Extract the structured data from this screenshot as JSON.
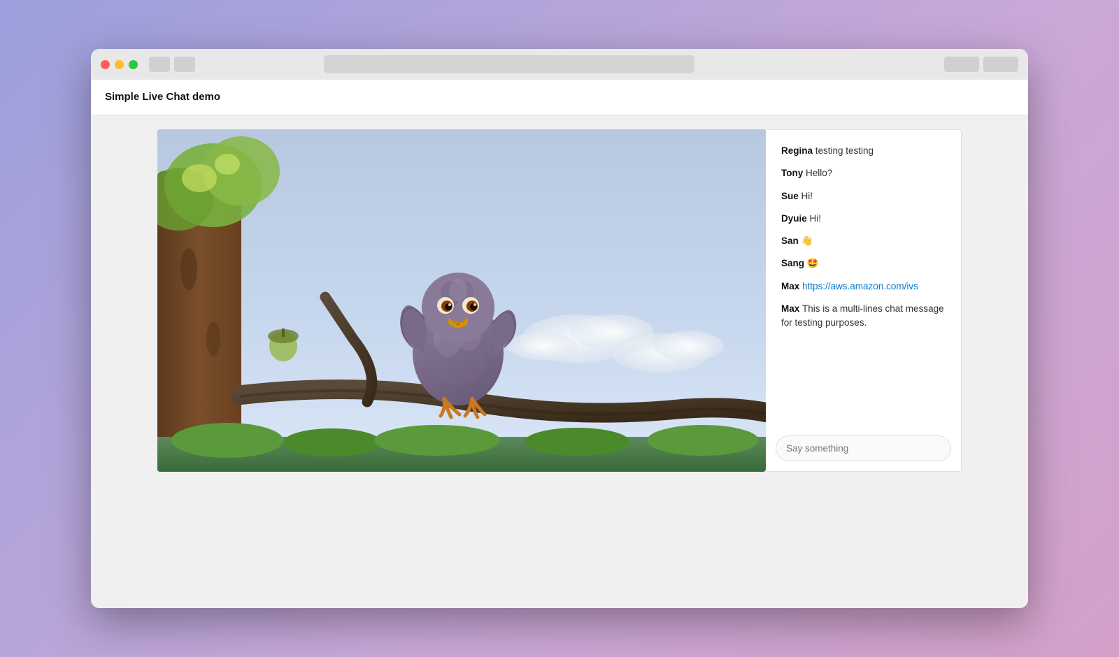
{
  "browser": {
    "title": "Simple Live Chat demo"
  },
  "chat": {
    "messages": [
      {
        "username": "Regina",
        "text": "testing testing",
        "link": null
      },
      {
        "username": "Tony",
        "text": "Hello?",
        "link": null
      },
      {
        "username": "Sue",
        "text": "Hi!",
        "link": null
      },
      {
        "username": "Dyuie",
        "text": "Hi!",
        "link": null
      },
      {
        "username": "San",
        "text": "👋",
        "link": null
      },
      {
        "username": "Sang",
        "text": "🤩",
        "link": null
      },
      {
        "username": "Max",
        "text": null,
        "link": "https://aws.amazon.com/ivs"
      },
      {
        "username": "Max",
        "text": "This is a multi-lines chat message for testing purposes.",
        "link": null
      }
    ],
    "input_placeholder": "Say something"
  }
}
